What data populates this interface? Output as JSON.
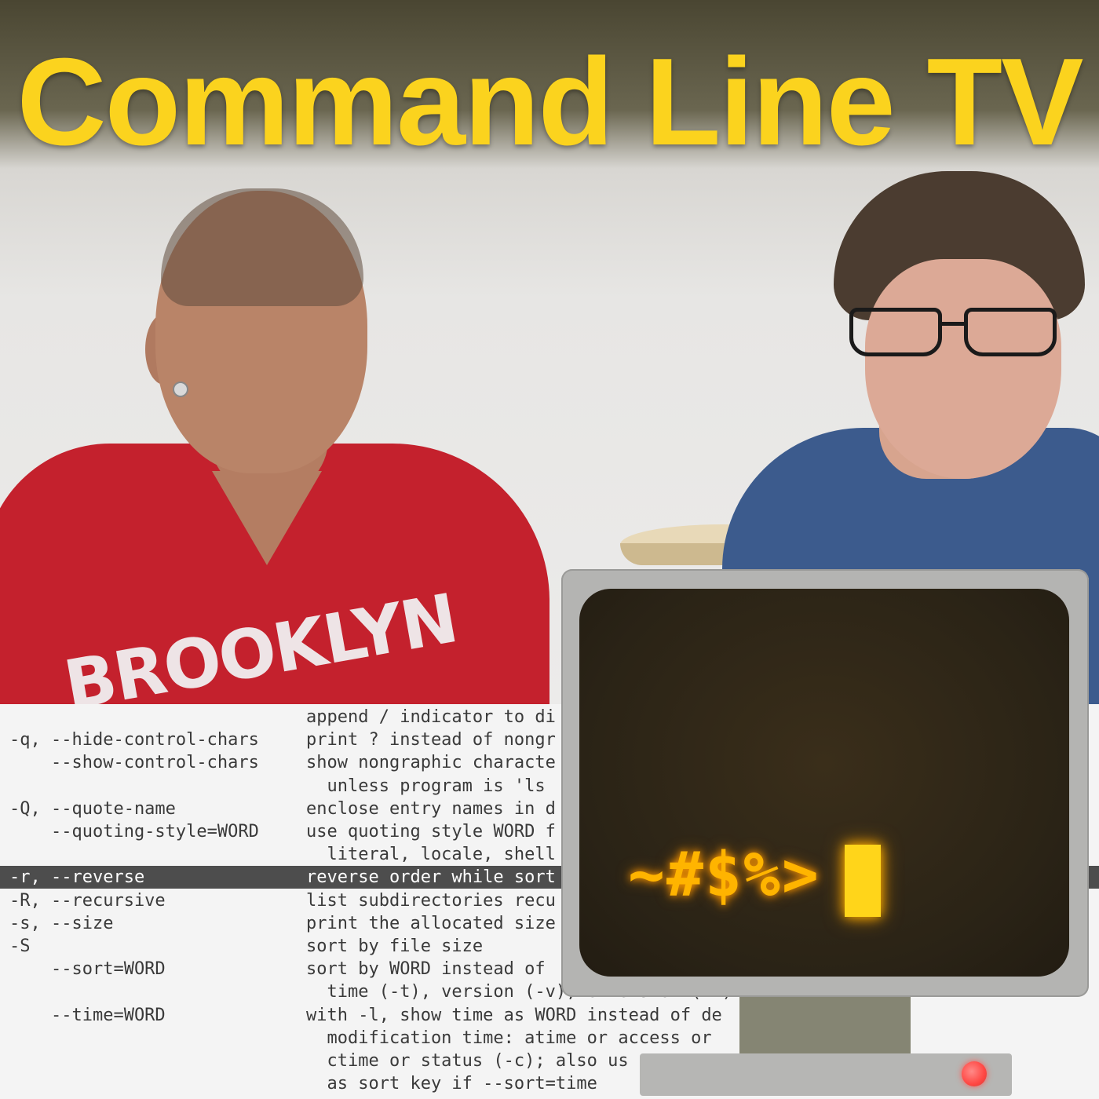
{
  "title": "Command Line TV",
  "shirt_text": "BROOKLYN",
  "manpage": {
    "rows": [
      {
        "opt": "",
        "desc": "append / indicator to di"
      },
      {
        "opt": "-q, --hide-control-chars",
        "desc": "print ? instead of nongr"
      },
      {
        "opt": "    --show-control-chars",
        "desc": "show nongraphic characte"
      },
      {
        "opt": "",
        "desc": "  unless program is 'ls"
      },
      {
        "opt": "-Q, --quote-name",
        "desc": "enclose entry names in d"
      },
      {
        "opt": "    --quoting-style=WORD",
        "desc": "use quoting style WORD f"
      },
      {
        "opt": "",
        "desc": "  literal, locale, shell"
      },
      {
        "opt": "-r, --reverse",
        "desc": "reverse order while sort",
        "highlighted": true
      },
      {
        "opt": "-R, --recursive",
        "desc": "list subdirectories recu"
      },
      {
        "opt": "-s, --size",
        "desc": "print the allocated size"
      },
      {
        "opt": "-S",
        "desc": "sort by file size"
      },
      {
        "opt": "    --sort=WORD",
        "desc": "sort by WORD instead of"
      },
      {
        "opt": "",
        "desc": "  time (-t), version (-v), extension (-X)"
      },
      {
        "opt": "    --time=WORD",
        "desc": "with -l, show time as WORD instead of de"
      },
      {
        "opt": "",
        "desc": "  modification time: atime or access or"
      },
      {
        "opt": "",
        "desc": "  ctime or status (-c); also us"
      },
      {
        "opt": "",
        "desc": "  as sort key if --sort=time"
      }
    ]
  },
  "terminal": {
    "prompt": "~#$%>",
    "icon": "retro-terminal-icon"
  },
  "colors": {
    "title": "#fbd31e",
    "prompt": "#ffb400",
    "highlight_row": "#4d4d4d",
    "led": "#ff4743"
  }
}
